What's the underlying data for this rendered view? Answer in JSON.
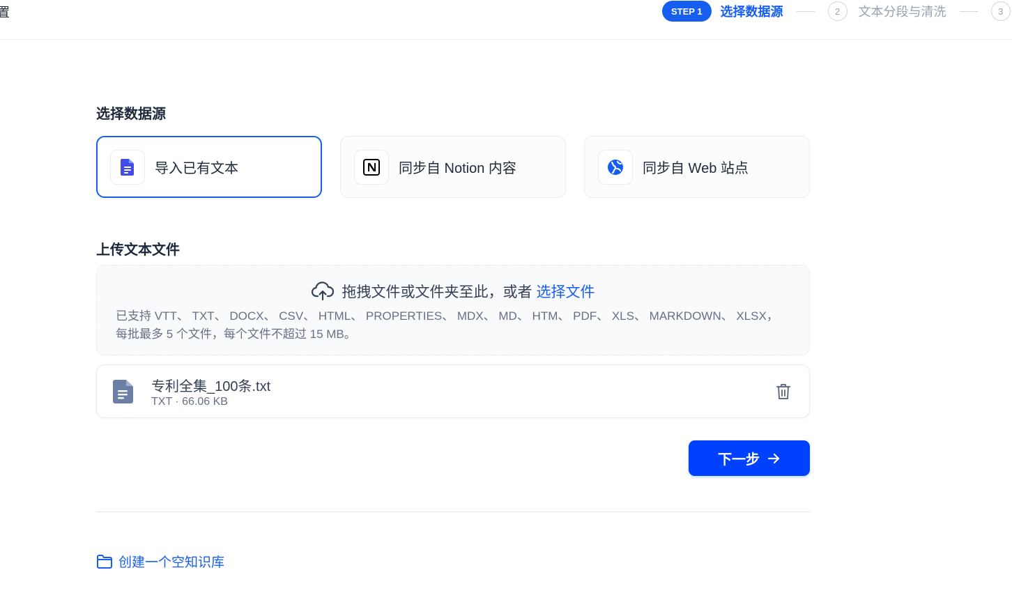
{
  "header": {
    "left_cut_text": "置",
    "steps": [
      {
        "badge": "STEP 1",
        "label": "选择数据源"
      },
      {
        "number": "2",
        "label": "文本分段与清洗"
      },
      {
        "number": "3"
      }
    ]
  },
  "data_source": {
    "title": "选择数据源",
    "options": [
      {
        "label": "导入已有文本",
        "icon": "document-icon",
        "selected": true
      },
      {
        "label": "同步自 Notion 内容",
        "icon": "notion-icon",
        "selected": false
      },
      {
        "label": "同步自 Web 站点",
        "icon": "globe-icon",
        "selected": false
      }
    ]
  },
  "upload": {
    "title": "上传文本文件",
    "drop_text": "拖拽文件或文件夹至此，或者",
    "select_link": "选择文件",
    "hint": "已支持 VTT、 TXT、 DOCX、 CSV、 HTML、 PROPERTIES、 MDX、 MD、 HTM、 PDF、 XLS、 MARKDOWN、 XLSX，每批最多 5 个文件，每个文件不超过 15 MB。"
  },
  "file": {
    "name": "专利全集_100条.txt",
    "meta": "TXT · 66.06 KB"
  },
  "actions": {
    "next_label": "下一步",
    "create_empty": "创建一个空知识库"
  },
  "colors": {
    "accent": "#155eef",
    "button": "#0040ff",
    "muted": "#98a2b3"
  }
}
